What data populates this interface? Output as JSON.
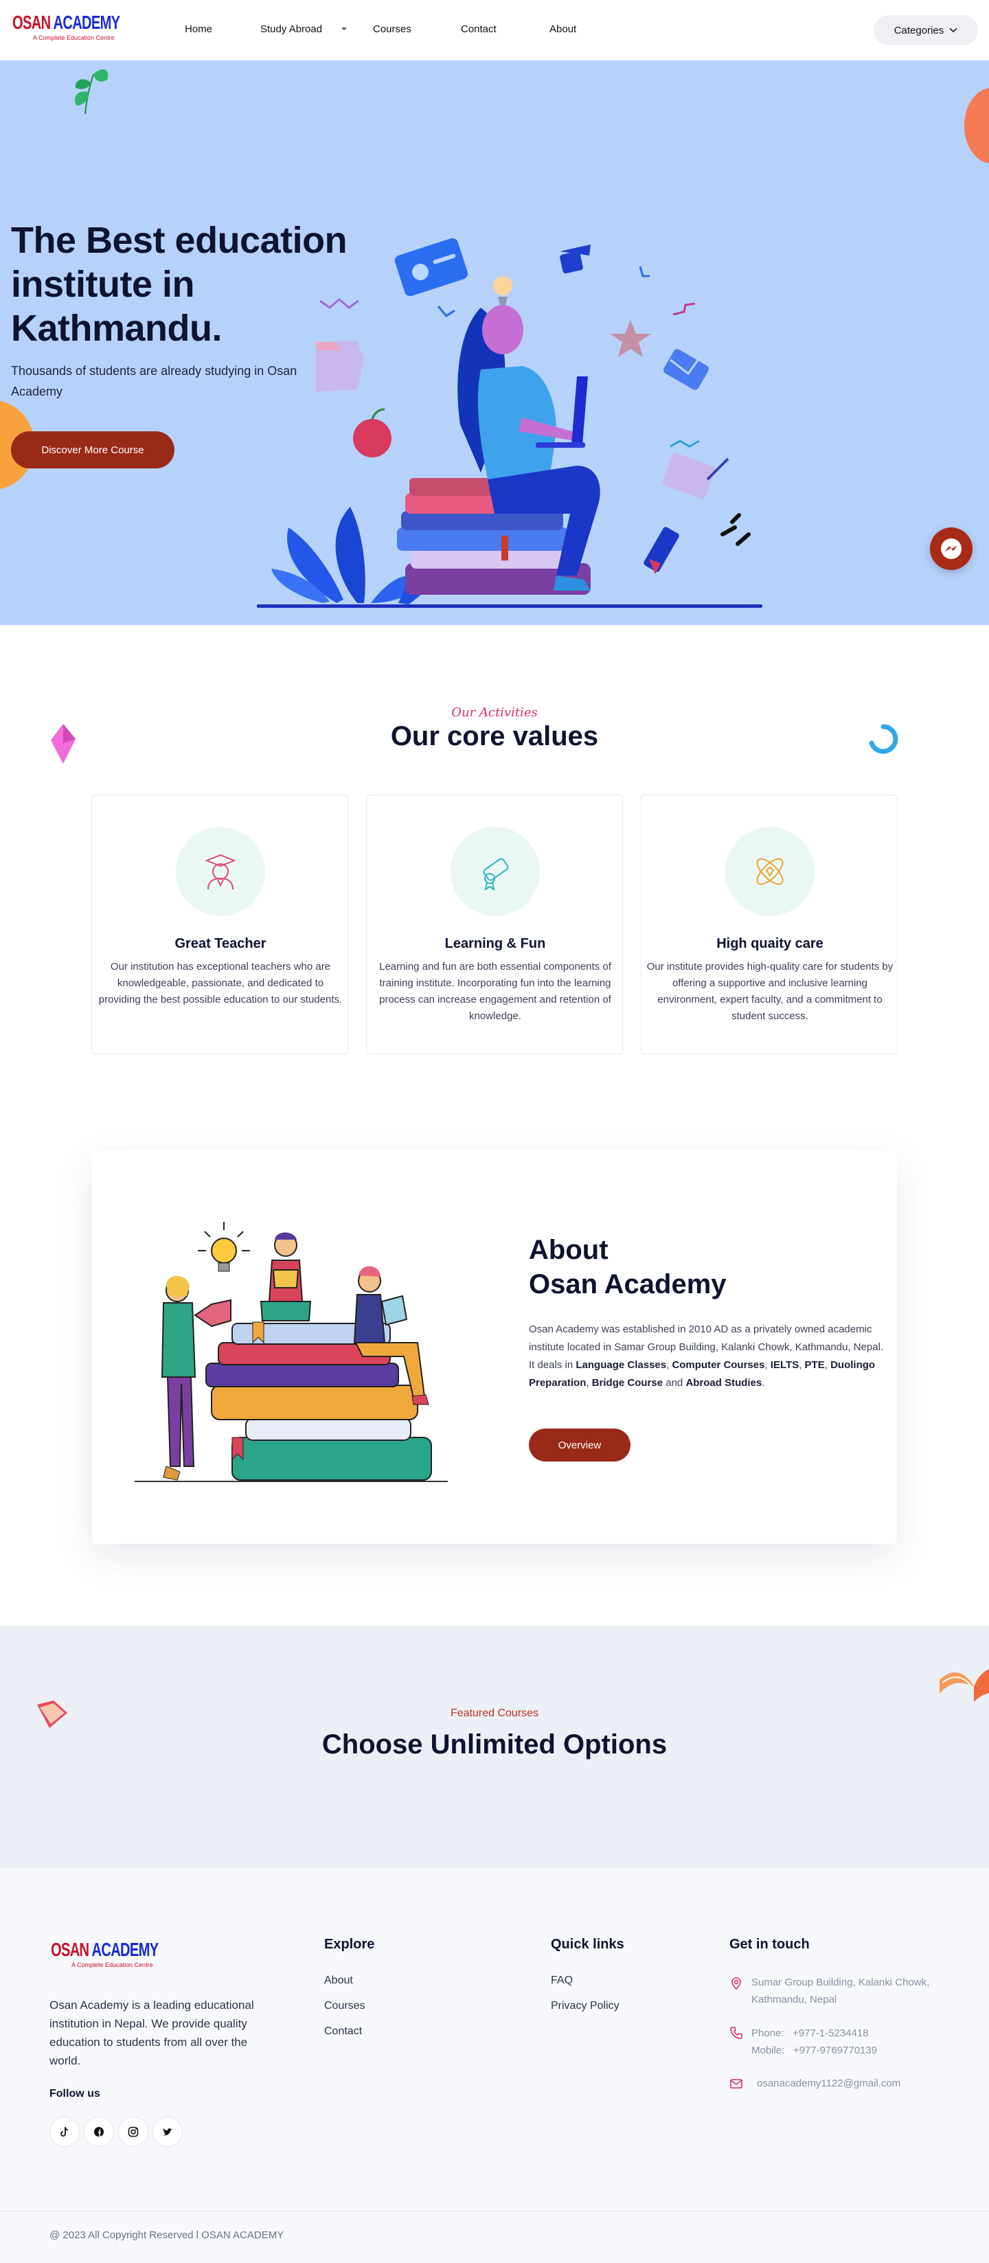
{
  "header": {
    "logo": {
      "word1": "OSAN",
      "word2": "ACADEMY",
      "tagline": "A Complete Education Centre"
    },
    "nav": [
      "Home",
      "Study Abroad",
      "Courses",
      "Contact",
      "About"
    ],
    "categories_label": "Categories"
  },
  "hero": {
    "title": "The Best education institute in Kathmandu.",
    "subtitle": "Thousands of students are already studying in Osan Academy",
    "button": "Discover More Course"
  },
  "values": {
    "eyebrow": "Our Activities",
    "title": "Our core values",
    "cards": [
      {
        "icon": "graduate-icon",
        "title": "Great Teacher",
        "text": "Our institution has exceptional teachers who are knowledgeable, passionate, and dedicated to providing the best possible education to our students."
      },
      {
        "icon": "diploma-icon",
        "title": "Learning & Fun",
        "text": "Learning and fun are both essential components of training institute. Incorporating fun into the learning process can increase engagement and retention of knowledge."
      },
      {
        "icon": "atom-icon",
        "title": "High quaity care",
        "text": "Our institute provides high-quality care for students by offering a supportive and inclusive learning environment, expert faculty, and a commitment to student success."
      }
    ]
  },
  "about": {
    "title_line1": "About",
    "title_line2": "Osan Academy",
    "text_intro": "Osan Academy was established in 2010 AD as a privately owned academic institute located in Samar Group Building, Kalanki Chowk, Kathmandu, Nepal. It deals in ",
    "offerings": [
      "Language Classes",
      "Computer Courses",
      "IELTS",
      "PTE",
      "Duolingo Preparation",
      "Bridge Course",
      "Abroad Studies"
    ],
    "sep_comma": ", ",
    "sep_and": " and ",
    "sep_end": ".",
    "button": "Overview"
  },
  "courses": {
    "eyebrow": "Featured Courses",
    "title": "Choose Unlimited Options"
  },
  "footer": {
    "about": "Osan Academy is a leading educational institution in Nepal. We provide quality education to students from all over the world.",
    "follow_label": "Follow us",
    "social": [
      "tiktok-icon",
      "facebook-icon",
      "instagram-icon",
      "twitter-icon"
    ],
    "explore": {
      "title": "Explore",
      "links": [
        "About",
        "Courses",
        "Contact"
      ]
    },
    "quick": {
      "title": "Quick links",
      "links": [
        "FAQ",
        "Privacy Policy"
      ]
    },
    "contact": {
      "title": "Get in touch",
      "address_line1": "Sumar Group Building, Kalanki Chowk,",
      "address_line2": "Kathmandu, Nepal",
      "phone_label": "Phone:",
      "phone": "+977-1-5234418",
      "mobile_label": "Mobile:",
      "mobile": "+977-9769770139",
      "email": "osanacademy1122@gmail.com"
    },
    "copyright": "@ 2023 All Copyright Reserved l OSAN ACADEMY"
  },
  "colors": {
    "brand_red": "#9a2a18",
    "hero_bg": "#b6d2fb",
    "dark": "#0e1330",
    "eyebrow_pink": "#d8306a"
  }
}
